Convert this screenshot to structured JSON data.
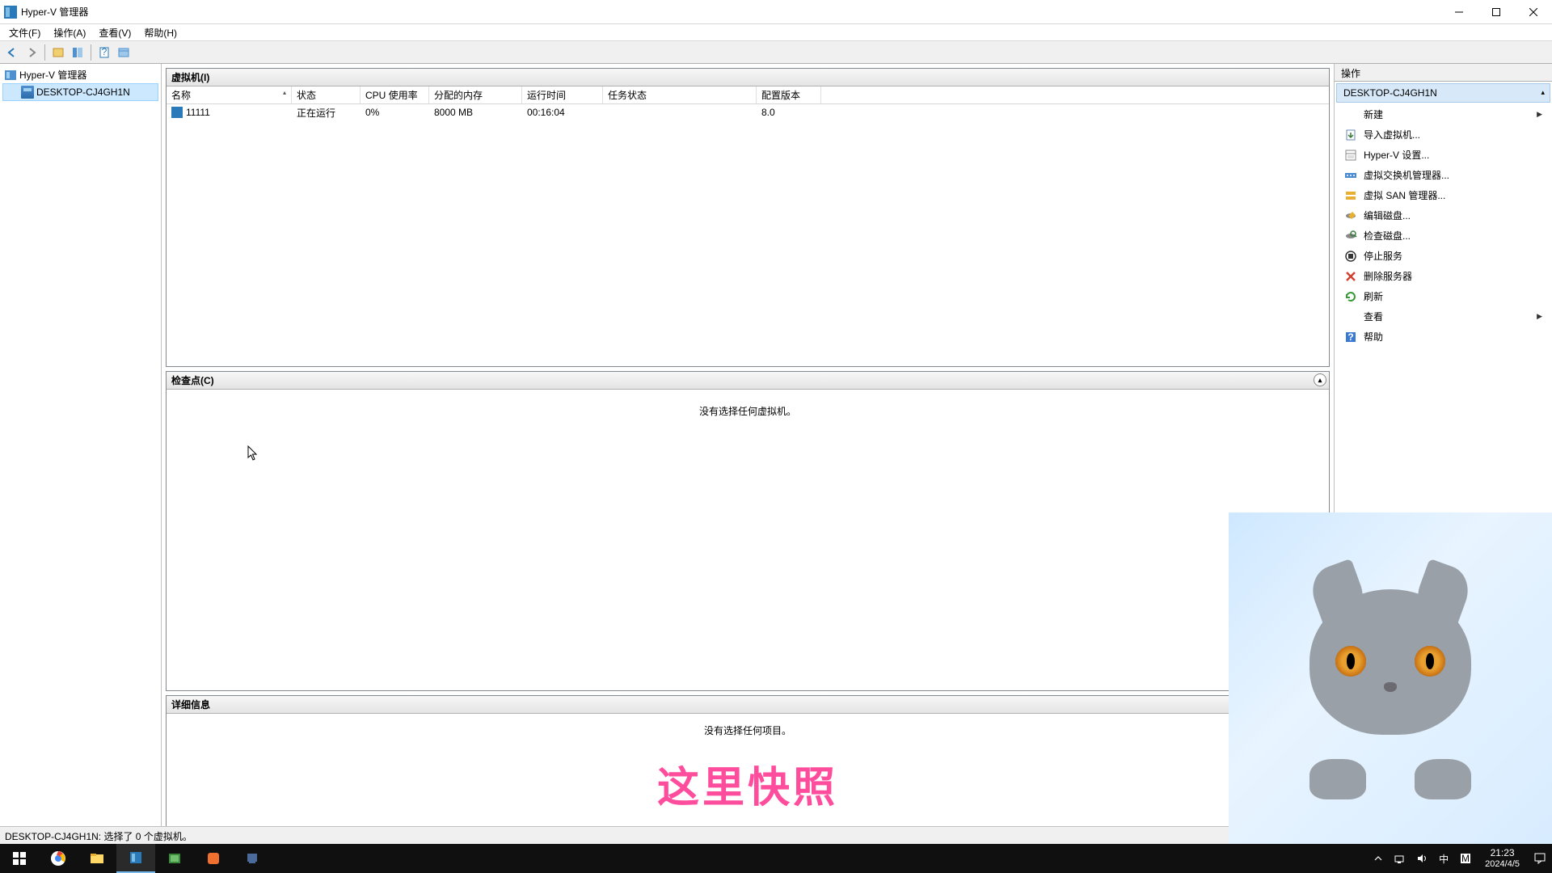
{
  "titlebar": {
    "title": "Hyper-V 管理器"
  },
  "menubar": {
    "file": "文件(F)",
    "action": "操作(A)",
    "view": "查看(V)",
    "help": "帮助(H)"
  },
  "tree": {
    "root": "Hyper-V 管理器",
    "host": "DESKTOP-CJ4GH1N"
  },
  "vm_panel": {
    "title": "虚拟机(I)",
    "columns": {
      "name": "名称",
      "state": "状态",
      "cpu": "CPU 使用率",
      "mem": "分配的内存",
      "uptime": "运行时间",
      "task": "任务状态",
      "ver": "配置版本"
    },
    "rows": [
      {
        "name": "11111",
        "state": "正在运行",
        "cpu": "0%",
        "mem": "8000 MB",
        "uptime": "00:16:04",
        "task": "",
        "ver": "8.0"
      }
    ]
  },
  "checkpoints": {
    "title": "检查点(C)",
    "empty": "没有选择任何虚拟机。"
  },
  "details": {
    "title": "详细信息",
    "empty": "没有选择任何项目。",
    "overlay": "这里快照"
  },
  "actions": {
    "title": "操作",
    "group": "DESKTOP-CJ4GH1N",
    "items": [
      {
        "label": "新建",
        "arrow": true,
        "icon": "blank"
      },
      {
        "label": "导入虚拟机...",
        "icon": "import"
      },
      {
        "label": "Hyper-V 设置...",
        "icon": "settings-page"
      },
      {
        "label": "虚拟交换机管理器...",
        "icon": "vswitch"
      },
      {
        "label": "虚拟 SAN 管理器...",
        "icon": "vsan"
      },
      {
        "label": "编辑磁盘...",
        "icon": "edit-disk"
      },
      {
        "label": "检查磁盘...",
        "icon": "inspect-disk"
      },
      {
        "label": "停止服务",
        "icon": "stop"
      },
      {
        "label": "删除服务器",
        "icon": "delete"
      },
      {
        "label": "刷新",
        "icon": "refresh"
      },
      {
        "label": "查看",
        "arrow": true,
        "icon": "blank"
      },
      {
        "label": "帮助",
        "icon": "help"
      }
    ]
  },
  "statusbar": "DESKTOP-CJ4GH1N: 选择了 0 个虚拟机。",
  "taskbar": {
    "time": "21:23",
    "date": "2024/4/5",
    "ime": "中"
  }
}
